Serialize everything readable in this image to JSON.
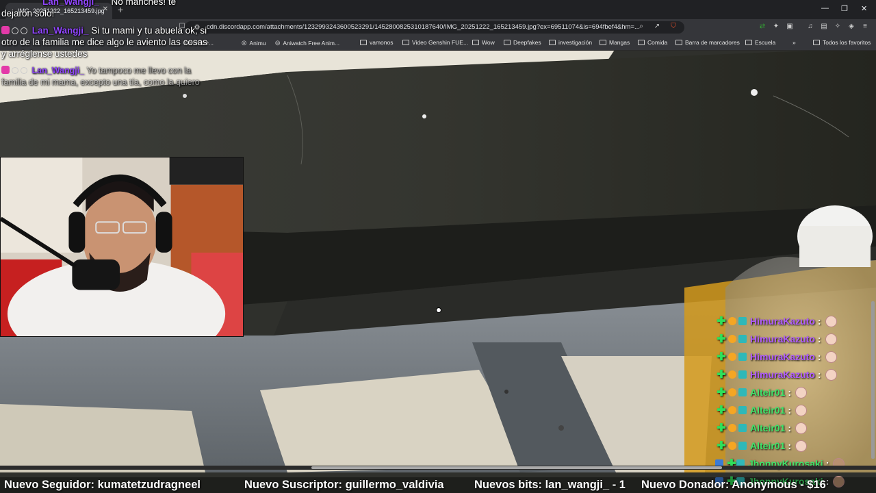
{
  "browser": {
    "tab_title": "IMG_20251222_165213459.jpg",
    "url": "cdn.discordapp.com/attachments/1232993243600523291/1452800825310187640/IMG_20251222_165213459.jpg?ex=69511074&is=694fbef4&hm=...",
    "bookmarks": [
      {
        "label": "me online...",
        "type": "link"
      },
      {
        "label": "Animu",
        "type": "link"
      },
      {
        "label": "Aniwatch Free Anim...",
        "type": "link"
      },
      {
        "label": "vamonos",
        "type": "folder"
      },
      {
        "label": "Video Genshin FUE...",
        "type": "folder"
      },
      {
        "label": "Wow",
        "type": "folder"
      },
      {
        "label": "Deepfakes",
        "type": "folder"
      },
      {
        "label": "investigación",
        "type": "folder"
      },
      {
        "label": "Mangas",
        "type": "folder"
      },
      {
        "label": "Comida",
        "type": "folder"
      },
      {
        "label": "Barra de marcadores",
        "type": "folder"
      },
      {
        "label": "Escuela",
        "type": "folder"
      },
      {
        "label": "Todos los favoritos",
        "type": "folder"
      }
    ]
  },
  "chat": {
    "messages": [
      {
        "user": "Lan_Wangji_",
        "text": "No manches! te dejaron solo!"
      },
      {
        "user": "Lan_Wangji_",
        "text": "Si tu mami y tu abuela ok, si otro de la familia me dice algo le aviento las cosas y arréglense ustedes"
      },
      {
        "user": "Lan_Wangji_",
        "text": "Yo tampoco me llevo con la familia de mi mama, excepto una tía, como la quiero"
      }
    ]
  },
  "alerts": [
    {
      "user": "HimuraKazuto",
      "color": "#b05bff"
    },
    {
      "user": "HimuraKazuto",
      "color": "#b05bff"
    },
    {
      "user": "HimuraKazuto",
      "color": "#b05bff"
    },
    {
      "user": "HimuraKazuto",
      "color": "#b05bff"
    },
    {
      "user": "Alteir01",
      "color": "#3fe36a"
    },
    {
      "user": "Alteir01",
      "color": "#3fe36a"
    },
    {
      "user": "Alteir01",
      "color": "#3fe36a"
    },
    {
      "user": "Alteir01",
      "color": "#3fe36a"
    },
    {
      "user": "JhonnyKurosaki",
      "color": "#3fe36a"
    },
    {
      "user": "JhonnyKurosaki",
      "color": "#3fe36a"
    }
  ],
  "ticker": {
    "follower": "Nuevo Seguidor: kumatetzudragneel",
    "subscriber": "Nuevo Suscriptor: guillermo_valdivia",
    "bits": "Nuevos bits: lan_wangji_ - 1",
    "donor": "Nuevo Donador: Anonymous - $16"
  }
}
